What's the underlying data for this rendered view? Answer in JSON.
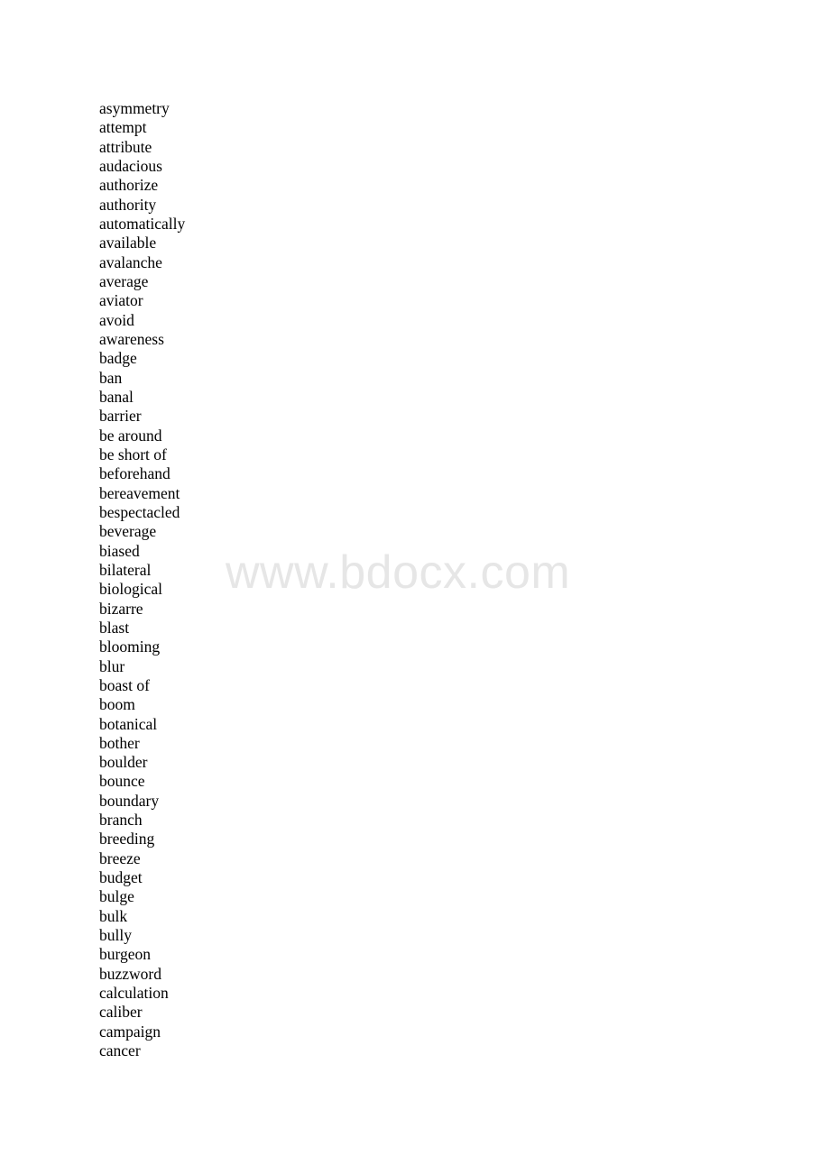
{
  "document": {
    "words": [
      "asymmetry",
      "attempt",
      "attribute",
      "audacious",
      "authorize",
      "authority",
      "automatically",
      "available",
      "avalanche",
      "average",
      "aviator",
      "avoid",
      "awareness",
      "badge",
      "ban",
      "banal",
      "barrier",
      "be around",
      "be short of",
      "beforehand",
      "bereavement",
      "bespectacled",
      "beverage",
      "biased",
      "bilateral",
      "biological",
      "bizarre",
      "blast",
      "blooming",
      "blur",
      "boast of",
      "boom",
      "botanical",
      "bother",
      "boulder",
      "bounce",
      "boundary",
      "branch",
      "breeding",
      "breeze",
      "budget",
      "bulge",
      "bulk",
      "bully",
      "burgeon",
      "buzzword",
      "calculation",
      "caliber",
      "campaign",
      "cancer"
    ],
    "watermark": "www.bdocx.com"
  }
}
